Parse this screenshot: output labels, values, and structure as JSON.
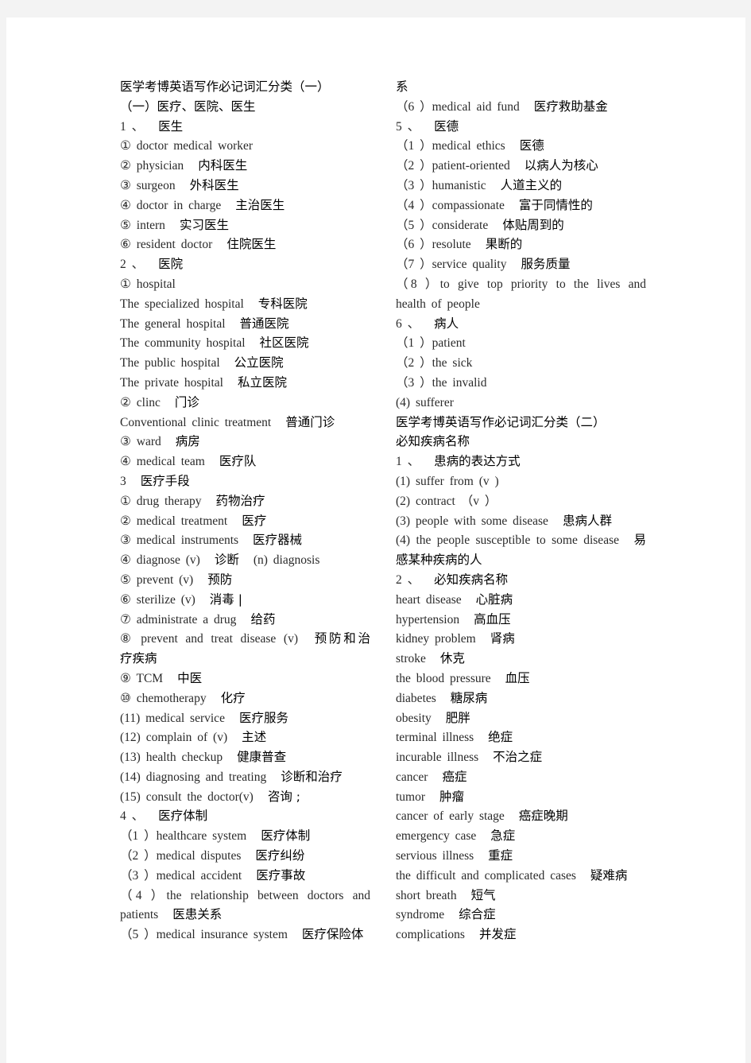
{
  "document": {
    "left_column": [
      {
        "zh": "医学考博英语写作必记词汇分类（一）"
      },
      {
        "zh": "（一）医疗、医院、医生"
      },
      {
        "en": "1 、",
        "zh": "医生"
      },
      {
        "en": "①  doctor medical worker"
      },
      {
        "en": "② physician",
        "zh": "内科医生"
      },
      {
        "en": "③ surgeon",
        "zh": "外科医生"
      },
      {
        "en": "④  doctor in charge",
        "zh": "主治医生"
      },
      {
        "en": "⑤ intern",
        "zh": "实习医生"
      },
      {
        "en": "⑥ resident doctor",
        "zh": "住院医生"
      },
      {
        "en": "2 、",
        "zh": "医院"
      },
      {
        "en": "① hospital"
      },
      {
        "en": "The specialized hospital",
        "zh": "专科医院"
      },
      {
        "en": "The general hospital",
        "zh": "普通医院"
      },
      {
        "en": "The community hospital",
        "zh": "社区医院"
      },
      {
        "en": "The public hospital",
        "zh": "公立医院"
      },
      {
        "en": "The private hospital",
        "zh": "私立医院"
      },
      {
        "en": "② clinc",
        "zh": "门诊"
      },
      {
        "en": "Conventional clinic treatment",
        "zh": "普通门诊"
      },
      {
        "en": "③ ward",
        "zh": "病房"
      },
      {
        "en": "④ medical team",
        "zh": "医疗队"
      },
      {
        "en": "3",
        "zh": "医疗手段"
      },
      {
        "en": "① drug therapy",
        "zh": "药物治疗"
      },
      {
        "en": "② medical treatment",
        "zh": "医疗"
      },
      {
        "en": "③ medical instruments",
        "zh": "医疗器械"
      },
      {
        "en": "④ diagnose (v)",
        "zh": "诊断",
        "en2": "(n) diagnosis"
      },
      {
        "en": "⑤ prevent (v)",
        "zh": "预防"
      },
      {
        "en": "⑥ sterilize (v)",
        "zh": "消毒 |"
      },
      {
        "en": "⑦  administrate a drug",
        "zh": "给药"
      },
      {
        "en": "⑧  prevent and treat disease (v)",
        "zh": "预防和治",
        "justify": true
      },
      {
        "zh": "疗疾病"
      },
      {
        "en": "⑨ TCM",
        "zh": "中医"
      },
      {
        "en": "⑩ chemotherapy",
        "zh": "化疗"
      },
      {
        "en": "(11) medical service",
        "zh": "医疗服务"
      },
      {
        "en": "(12) complain of (v)",
        "zh": "主述"
      },
      {
        "en": "(13) health checkup",
        "zh": "健康普查"
      },
      {
        "en": "(14) diagnosing and treating",
        "zh": "诊断和治疗"
      },
      {
        "en": "(15) consult the doctor(v)",
        "zh": "咨询 ;"
      },
      {
        "en": "4 、",
        "zh": "医疗体制"
      },
      {
        "en": "（1 ）healthcare system",
        "zh": "医疗体制"
      },
      {
        "en": "（2 ）medical disputes",
        "zh": "医疗纠纷"
      },
      {
        "en": "（3 ）medical accident",
        "zh": "医疗事故"
      },
      {
        "en": "（4 ）the relationship between doctors and",
        "justify": true
      },
      {
        "en": "patients",
        "zh": "医患关系"
      },
      {
        "en": "（5 ）medical insurance system",
        "zh": "医疗保险体"
      }
    ],
    "right_column": [
      {
        "zh": "系"
      },
      {
        "en": "（6 ）medical aid fund",
        "zh": "医疗救助基金"
      },
      {
        "en": "5 、",
        "zh": "医德"
      },
      {
        "en": "（1 ）medical ethics",
        "zh": "医德"
      },
      {
        "en": "（2 ）patient-oriented",
        "zh": "以病人为核心"
      },
      {
        "en": "（3 ）humanistic",
        "zh": "人道主义的"
      },
      {
        "en": "（4 ）compassionate",
        "zh": "富于同情性的"
      },
      {
        "en": "（5 ）considerate",
        "zh": "体贴周到的"
      },
      {
        "en": "（6 ）resolute",
        "zh": "果断的"
      },
      {
        "en": "（7 ）service quality",
        "zh": "服务质量"
      },
      {
        "en": "（8 ）to give top priority to the lives and",
        "justify": true
      },
      {
        "en": "health of people"
      },
      {
        "en": "6 、",
        "zh": "病人"
      },
      {
        "en": "（1 ）patient"
      },
      {
        "en": "（2 ）the sick"
      },
      {
        "en": "（3 ）the invalid"
      },
      {
        "en": "(4) sufferer"
      },
      {
        "zh": "医学考博英语写作必记词汇分类（二）"
      },
      {
        "zh": "必知疾病名称"
      },
      {
        "en": "1 、",
        "zh": "患病的表达方式"
      },
      {
        "en": "(1)  suffer from (v )"
      },
      {
        "en": "(2) contract    （v  ）"
      },
      {
        "en": "(3) people with some disease",
        "zh": "患病人群"
      },
      {
        "en": "(4) the people susceptible to some disease",
        "zh": "易",
        "justify": true
      },
      {
        "zh": "感某种疾病的人"
      },
      {
        "en": "2 、",
        "zh": "必知疾病名称"
      },
      {
        "en": "heart disease",
        "zh": "心脏病"
      },
      {
        "en": "hypertension",
        "zh": "高血压"
      },
      {
        "en": "kidney problem",
        "zh": "肾病"
      },
      {
        "en": "stroke",
        "zh": "休克"
      },
      {
        "en": "the blood pressure",
        "zh": "血压"
      },
      {
        "en": "diabetes",
        "zh": "糖尿病"
      },
      {
        "en": "obesity",
        "zh": "肥胖"
      },
      {
        "en": "terminal illness",
        "zh": "绝症"
      },
      {
        "en": "incurable illness",
        "zh": "不治之症"
      },
      {
        "en": "cancer",
        "zh": "癌症"
      },
      {
        "en": "tumor",
        "zh": "肿瘤"
      },
      {
        "en": "cancer of early stage",
        "zh": "癌症晚期"
      },
      {
        "en": "emergency case",
        "zh": "急症"
      },
      {
        "en": "servious illness",
        "zh": "重症"
      },
      {
        "en": "the difficult and complicated cases",
        "zh": "疑难病"
      },
      {
        "en": "short breath",
        "zh": "短气"
      },
      {
        "en": "syndrome",
        "zh": "综合症"
      },
      {
        "en": "complications",
        "zh": "并发症"
      }
    ]
  }
}
